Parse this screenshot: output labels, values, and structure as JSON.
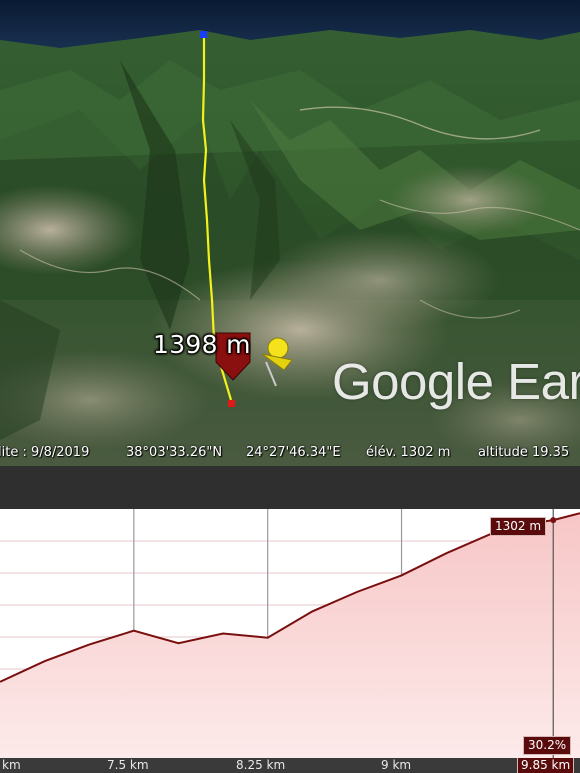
{
  "viewport": {
    "elevation_label": "1398 m",
    "watermark": "Google Ear"
  },
  "statusbar": {
    "imagery_date": "lite : 9/8/2019",
    "latitude": "38°03'33.26\"N",
    "longitude": "24°27'46.34\"E",
    "elevation": "élév. 1302 m",
    "altitude": "altitude  19.35"
  },
  "profile": {
    "hover_elevation": "1302 m",
    "slope": "30.2%",
    "axis_ticks": [
      "km",
      "7.5 km",
      "8.25 km",
      "9 km"
    ],
    "current_distance": "9.85 km",
    "colors": {
      "line": "#7a0f0f",
      "fill_top": "#f7c6c6",
      "fill_bottom": "#fdeaea",
      "tag": "#5a0c0c"
    }
  },
  "chart_data": {
    "type": "area",
    "xlabel": "",
    "ylabel": "",
    "x_unit": "km",
    "x": [
      6.75,
      7.0,
      7.25,
      7.5,
      7.75,
      8.0,
      8.25,
      8.5,
      8.75,
      9.0,
      9.25,
      9.5,
      9.75,
      9.85,
      10.0
    ],
    "y": [
      1185,
      1200,
      1212,
      1222,
      1213,
      1220,
      1217,
      1236,
      1250,
      1262,
      1278,
      1292,
      1300,
      1302,
      1307
    ]
  }
}
